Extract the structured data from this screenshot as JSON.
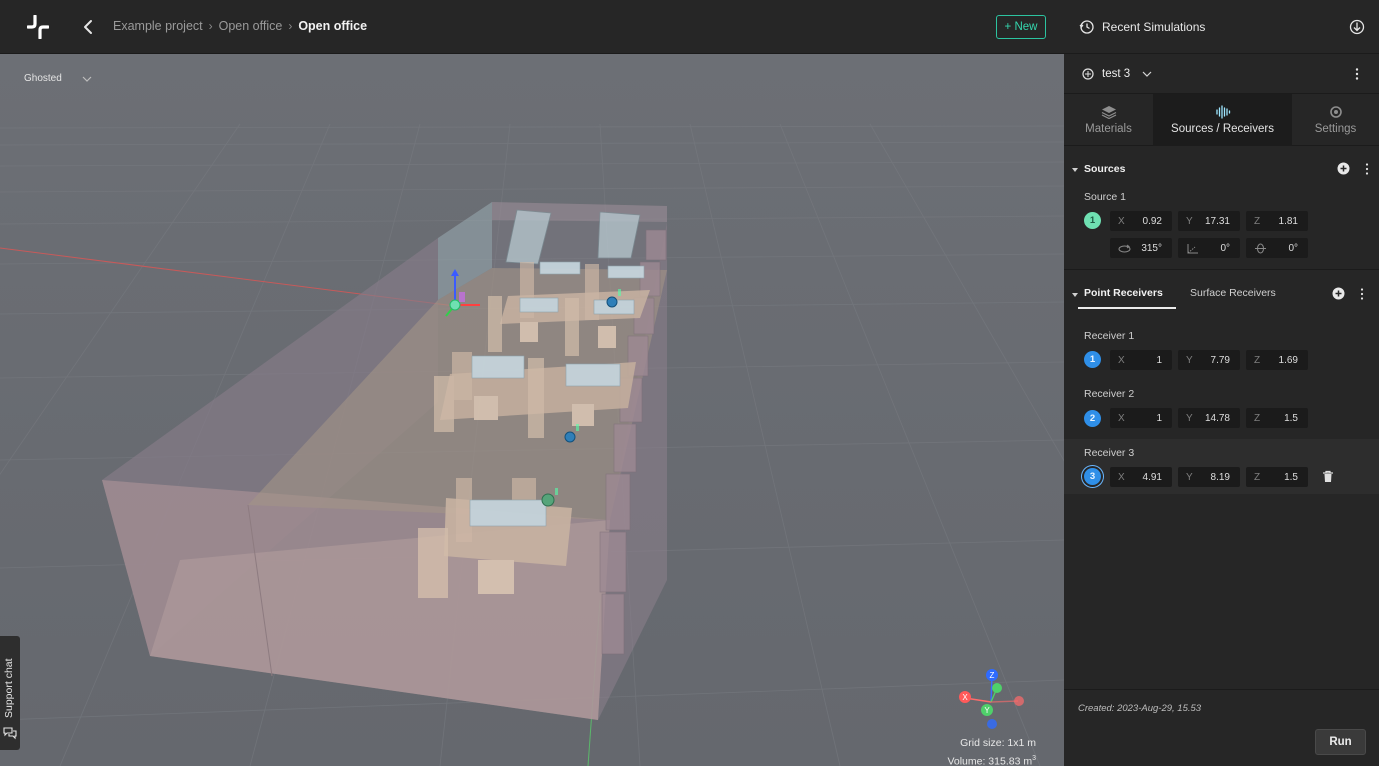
{
  "topbar": {
    "breadcrumb": [
      "Example project",
      "Open office",
      "Open office"
    ],
    "breadcrumb_separator": "›",
    "new_button": "+ New"
  },
  "viewport": {
    "view_mode": "Ghosted",
    "support_chat": "Support chat",
    "grid_size": "Grid size: 1x1 m",
    "volume": "Volume: 315.83 m",
    "volume_unit_superscript": "3",
    "axes": {
      "x": "X",
      "y": "Y",
      "z": "Z"
    }
  },
  "panel": {
    "title": "Recent Simulations",
    "simulation_name": "test 3",
    "tabs": [
      {
        "label": "Materials",
        "icon": "layers-icon",
        "active": false
      },
      {
        "label": "Sources / Receivers",
        "icon": "soundwave-icon",
        "active": true
      },
      {
        "label": "Settings",
        "icon": "gear-icon",
        "active": false
      }
    ],
    "sources_heading": "Sources",
    "source": {
      "name": "Source 1",
      "badge": "1",
      "x_label": "X",
      "x": "0.92",
      "y_label": "Y",
      "y": "17.31",
      "z_label": "Z",
      "z": "1.81",
      "azimuth": "315°",
      "elevation": "0°",
      "roll": "0°"
    },
    "receiver_tabs": [
      "Point Receivers",
      "Surface Receivers"
    ],
    "receivers": [
      {
        "name": "Receiver 1",
        "badge": "1",
        "x": "1",
        "y": "7.79",
        "z": "1.69"
      },
      {
        "name": "Receiver 2",
        "badge": "2",
        "x": "1",
        "y": "14.78",
        "z": "1.5"
      },
      {
        "name": "Receiver 3",
        "badge": "3",
        "x": "4.91",
        "y": "8.19",
        "z": "1.5"
      }
    ],
    "created": "Created: 2023-Aug-29, 15.53",
    "run_button": "Run"
  },
  "colors": {
    "accent_new": "#35d6ae",
    "source_badge": "#6fe0b2",
    "receiver_badge": "#2f8fe8",
    "viewport_bg": "#6a6d73",
    "panel_bg": "#262626"
  }
}
